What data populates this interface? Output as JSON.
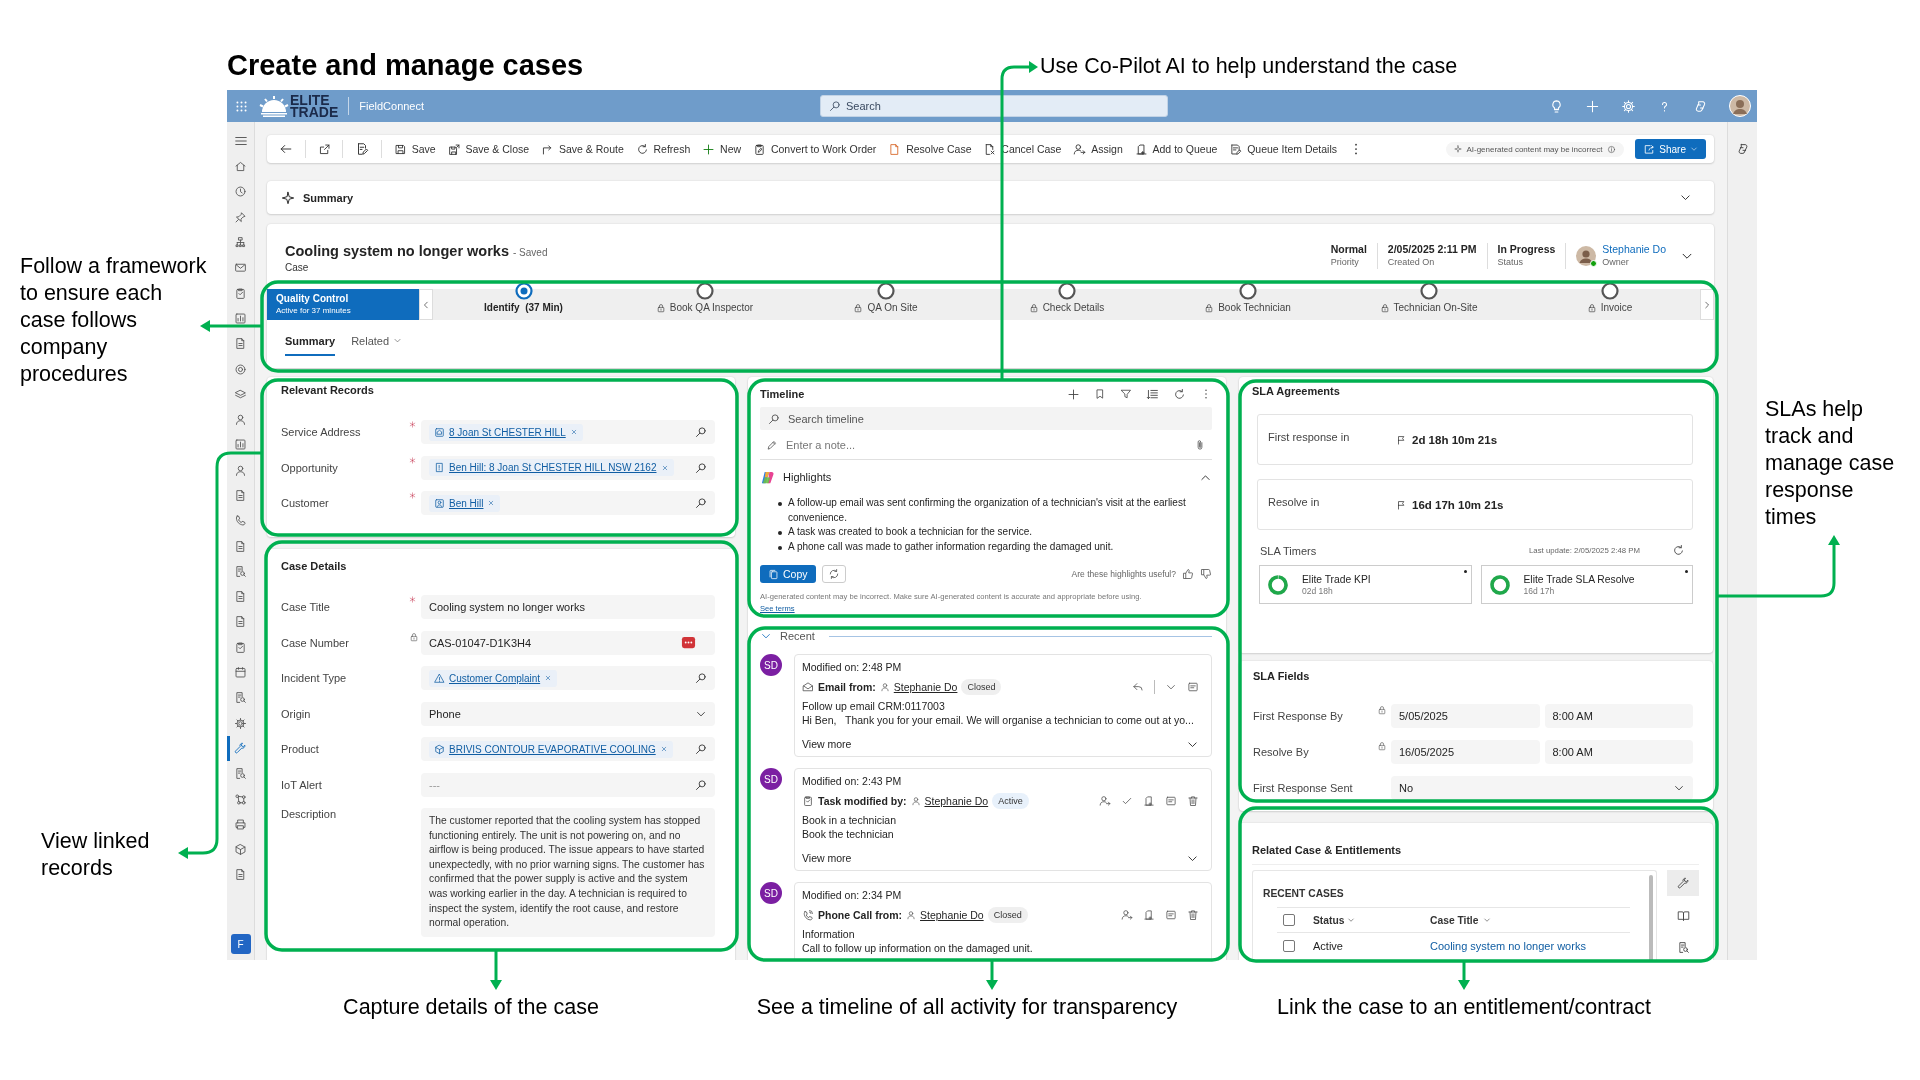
{
  "title": "Create and manage cases",
  "annotations": [
    "Use Co-Pilot AI to help understand the case",
    "Follow a framework to ensure each case follows company procedures",
    "View linked records",
    "SLAs help track and manage case response times",
    "Capture details of the case",
    "See a timeline of all activity for transparency",
    "Link the case to an entitlement/contract"
  ],
  "top_bar": {
    "logo_lines": [
      "ELITE",
      "TRADE"
    ],
    "app_name": "FieldConnect",
    "search": {
      "placeholder": "Search"
    }
  },
  "nav_items": [
    {
      "selected": false
    },
    {
      "selected": false
    },
    {
      "selected": false
    },
    {
      "selected": false
    },
    {
      "selected": false
    },
    {
      "selected": false
    },
    {
      "selected": false
    },
    {
      "selected": false
    },
    {
      "selected": false
    },
    {
      "selected": false
    },
    {
      "selected": false
    },
    {
      "selected": false
    },
    {
      "selected": false
    },
    {
      "selected": false
    },
    {
      "selected": false
    },
    {
      "selected": false
    },
    {
      "selected": false
    },
    {
      "selected": false
    },
    {
      "selected": false
    },
    {
      "selected": false
    },
    {
      "selected": false
    },
    {
      "selected": false
    },
    {
      "selected": false
    },
    {
      "selected": true
    },
    {
      "selected": false
    },
    {
      "selected": false
    },
    {
      "selected": false
    },
    {
      "selected": false
    },
    {
      "selected": false
    }
  ],
  "area_switcher": "F",
  "command_bar": {
    "buttons": [
      "Save",
      "Save & Close",
      "Save & Route",
      "Refresh",
      "New",
      "Convert to Work Order",
      "Resolve Case",
      "Cancel Case",
      "Assign",
      "Add to Queue",
      "Queue Item Details"
    ],
    "ai_notice": "AI-generated content may be incorrect",
    "share": "Share"
  },
  "summary_bar": {
    "label": "Summary",
    "expanded": false
  },
  "header": {
    "title": "Cooling system no longer works",
    "saved": "- Saved",
    "entity": "Case",
    "fields": [
      {
        "value": "Normal",
        "label": "Priority"
      },
      {
        "value": "2/05/2025 2:11 PM",
        "label": "Created On"
      },
      {
        "value": "In Progress",
        "label": "Status"
      }
    ],
    "owner": {
      "name": "Stephanie Do",
      "label": "Owner",
      "online": true
    }
  },
  "bpf": {
    "active_stage": {
      "name": "Quality Control",
      "duration": "Active for 37 minutes"
    },
    "stages": [
      {
        "label": "Identify  (37 Min)",
        "selected": true,
        "locked": false
      },
      {
        "label": "Book QA Inspector",
        "selected": false,
        "locked": true
      },
      {
        "label": "QA On Site",
        "selected": false,
        "locked": true
      },
      {
        "label": "Check Details",
        "selected": false,
        "locked": true
      },
      {
        "label": "Book Technician",
        "selected": false,
        "locked": true
      },
      {
        "label": "Technician On-Site",
        "selected": false,
        "locked": true
      },
      {
        "label": "Invoice",
        "selected": false,
        "locked": true
      }
    ]
  },
  "tabs": [
    {
      "label": "Summary",
      "selected": true,
      "has_menu": false
    },
    {
      "label": "Related",
      "selected": false,
      "has_menu": true
    }
  ],
  "relevant_records": {
    "title": "Relevant Records",
    "fields": [
      {
        "label": "Service Address",
        "required": true,
        "kind": "lookup",
        "value": "8 Joan St CHESTER HILL"
      },
      {
        "label": "Opportunity",
        "required": true,
        "kind": "lookup",
        "value": "Ben Hill: 8 Joan St CHESTER HILL NSW 2162"
      },
      {
        "label": "Customer",
        "required": true,
        "kind": "lookup",
        "value": "Ben Hill"
      }
    ]
  },
  "case_details": {
    "title": "Case Details",
    "fields": [
      {
        "label": "Case Title",
        "required": true,
        "kind": "text",
        "value": "Cooling system no longer works"
      },
      {
        "label": "Case Number",
        "locked": true,
        "kind": "id",
        "value": "CAS-01047-D1K3H4"
      },
      {
        "label": "Incident Type",
        "kind": "lookup",
        "value": "Customer Complaint"
      },
      {
        "label": "Origin",
        "kind": "select",
        "value": "Phone"
      },
      {
        "label": "Product",
        "kind": "lookup",
        "value": "BRIVIS CONTOUR EVAPORATIVE COOLING"
      },
      {
        "label": "IoT Alert",
        "kind": "lookup",
        "placeholder": "---"
      },
      {
        "label": "Description",
        "kind": "textarea",
        "value": "The customer reported that the cooling system has stopped functioning entirely. The unit is not powering on, and no airflow is being produced. The issue appears to have started unexpectedly, with no prior warning signs. The customer has confirmed that the power supply is active and the system was working earlier in the day. A technician is required to inspect the system, identify the root cause, and restore normal operation."
      }
    ]
  },
  "timeline": {
    "title": "Timeline",
    "search_placeholder": "Search timeline",
    "note_placeholder": "Enter a note...",
    "highlights": {
      "title": "Highlights",
      "expanded": true,
      "items": [
        "A follow-up email was sent confirming the organization of a technician's visit at the earliest convenience.",
        "A task was created to book a technician for the service.",
        "A phone call was made to gather information regarding the damaged unit."
      ],
      "copy": "Copy",
      "question": "Are these highlights useful?",
      "disclaimer": "AI-generated content may be incorrect. Make sure AI-generated content is accurate and appropriate before using.",
      "terms": "See terms"
    },
    "recent": {
      "label": "Recent",
      "expanded": true
    },
    "entries": [
      {
        "kind": "email",
        "avatar": "SD",
        "modified": "Modified on: 2:48 PM",
        "type_label": "Email from:",
        "person": "Stephanie Do",
        "status": "Closed",
        "color": "#efefef",
        "lines": [
          "Follow up email CRM:0117003",
          "Hi Ben,   Thank you for your email. We will organise a technician to come out at yo..."
        ],
        "more": "View more"
      },
      {
        "kind": "task",
        "avatar": "SD",
        "modified": "Modified on: 2:43 PM",
        "type_label": "Task modified by:",
        "person": "Stephanie Do",
        "status": "Active",
        "color": "#e8f1fb",
        "lines": [
          "Book in a technician",
          "Book the technician"
        ],
        "more": "View more"
      },
      {
        "kind": "phone",
        "avatar": "SD",
        "modified": "Modified on: 2:34 PM",
        "type_label": "Phone Call from:",
        "person": "Stephanie Do",
        "status": "Closed",
        "color": "#efefef",
        "lines": [
          "Information",
          "Call to follow up information on the damaged unit."
        ]
      }
    ]
  },
  "sla_agreements": {
    "title": "SLA Agreements",
    "timers": [
      {
        "label": "First response in",
        "value": "2d 18h 10m 21s"
      },
      {
        "label": "Resolve in",
        "value": "16d 17h 10m 21s"
      }
    ],
    "sla_timers": {
      "title": "SLA Timers",
      "updated": "Last update: 2/05/2025 2:48 PM",
      "items": [
        {
          "name": "Elite Trade KPI",
          "time": "02d 18h",
          "level": 0.98
        },
        {
          "name": "Elite Trade SLA Resolve",
          "time": "16d 17h",
          "level": 1
        }
      ]
    }
  },
  "sla_fields": {
    "title": "SLA Fields",
    "fields": [
      {
        "label": "First Response By",
        "locked": true,
        "kind": "datetime",
        "date": "5/05/2025",
        "time": "8:00 AM"
      },
      {
        "label": "Resolve By",
        "locked": true,
        "kind": "datetime",
        "date": "16/05/2025",
        "time": "8:00 AM"
      },
      {
        "label": "First Response Sent",
        "locked": false,
        "kind": "select",
        "value": "No"
      }
    ]
  },
  "related": {
    "title": "Related Case & Entitlements",
    "grid_title": "RECENT CASES",
    "all_checked": false,
    "columns": [
      "Status",
      "Case Title"
    ],
    "rows": [
      {
        "status": "Active",
        "title": "Cooling system no longer works",
        "selected": false
      }
    ]
  }
}
